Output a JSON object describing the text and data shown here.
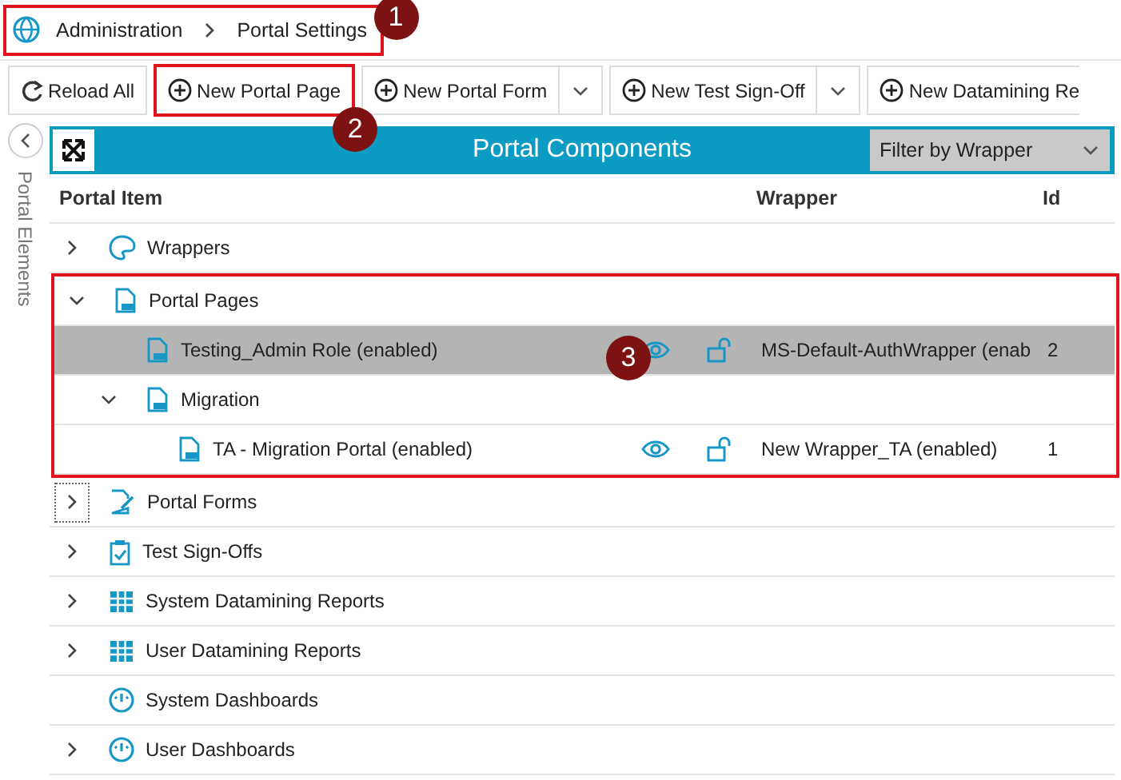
{
  "breadcrumb": [
    {
      "label": "Administration"
    },
    {
      "label": "Portal Settings"
    }
  ],
  "toolbar": [
    {
      "kind": "reload",
      "label": "Reload All",
      "dropdown": false
    },
    {
      "kind": "add",
      "label": "New Portal Page",
      "dropdown": false
    },
    {
      "kind": "add",
      "label": "New Portal Form",
      "dropdown": true
    },
    {
      "kind": "add",
      "label": "New Test Sign-Off",
      "dropdown": true
    },
    {
      "kind": "add",
      "label": "New Datamining Re",
      "dropdown": false
    }
  ],
  "sidebar": {
    "label": "Portal Elements"
  },
  "panel": {
    "title": "Portal Components",
    "filter": {
      "value": "Filter by Wrapper"
    }
  },
  "columns": [
    "Portal Item",
    "Wrapper",
    "Id"
  ],
  "tree": [
    {
      "kind": "wrapper-group",
      "label": "Wrappers",
      "expandable": true,
      "expanded": false,
      "selected": false,
      "focused": false
    },
    {
      "kind": "page-group",
      "label": "Portal Pages",
      "expandable": true,
      "expanded": true,
      "selected": false,
      "focused": false,
      "children": [
        {
          "kind": "page",
          "label": "Testing_Admin Role (enabled)",
          "expandable": false,
          "selected": true,
          "focused": false,
          "wrapper": "MS-Default-AuthWrapper (enab",
          "id": "2"
        },
        {
          "kind": "page-folder",
          "label": "Migration",
          "expandable": true,
          "expanded": true,
          "selected": false,
          "focused": false,
          "children": [
            {
              "kind": "page",
              "label": "TA - Migration Portal (enabled)",
              "expandable": false,
              "selected": false,
              "focused": false,
              "wrapper": "New Wrapper_TA (enabled)",
              "id": "1"
            }
          ]
        }
      ]
    },
    {
      "kind": "form-group",
      "label": "Portal Forms",
      "expandable": true,
      "expanded": false,
      "selected": false,
      "focused": true
    },
    {
      "kind": "signoff-group",
      "label": "Test Sign-Offs",
      "expandable": true,
      "expanded": false,
      "selected": false,
      "focused": false
    },
    {
      "kind": "report-group",
      "label": "System Datamining Reports",
      "expandable": true,
      "expanded": false,
      "selected": false,
      "focused": false
    },
    {
      "kind": "report-group",
      "label": "User Datamining Reports",
      "expandable": true,
      "expanded": false,
      "selected": false,
      "focused": false
    },
    {
      "kind": "dashboard-group",
      "label": "System Dashboards",
      "expandable": false,
      "selected": false,
      "focused": false
    },
    {
      "kind": "dashboard-group",
      "label": "User Dashboards",
      "expandable": true,
      "expanded": false,
      "selected": false,
      "focused": false
    }
  ],
  "annotations": [
    {
      "number": "1"
    },
    {
      "number": "2"
    },
    {
      "number": "3"
    }
  ]
}
